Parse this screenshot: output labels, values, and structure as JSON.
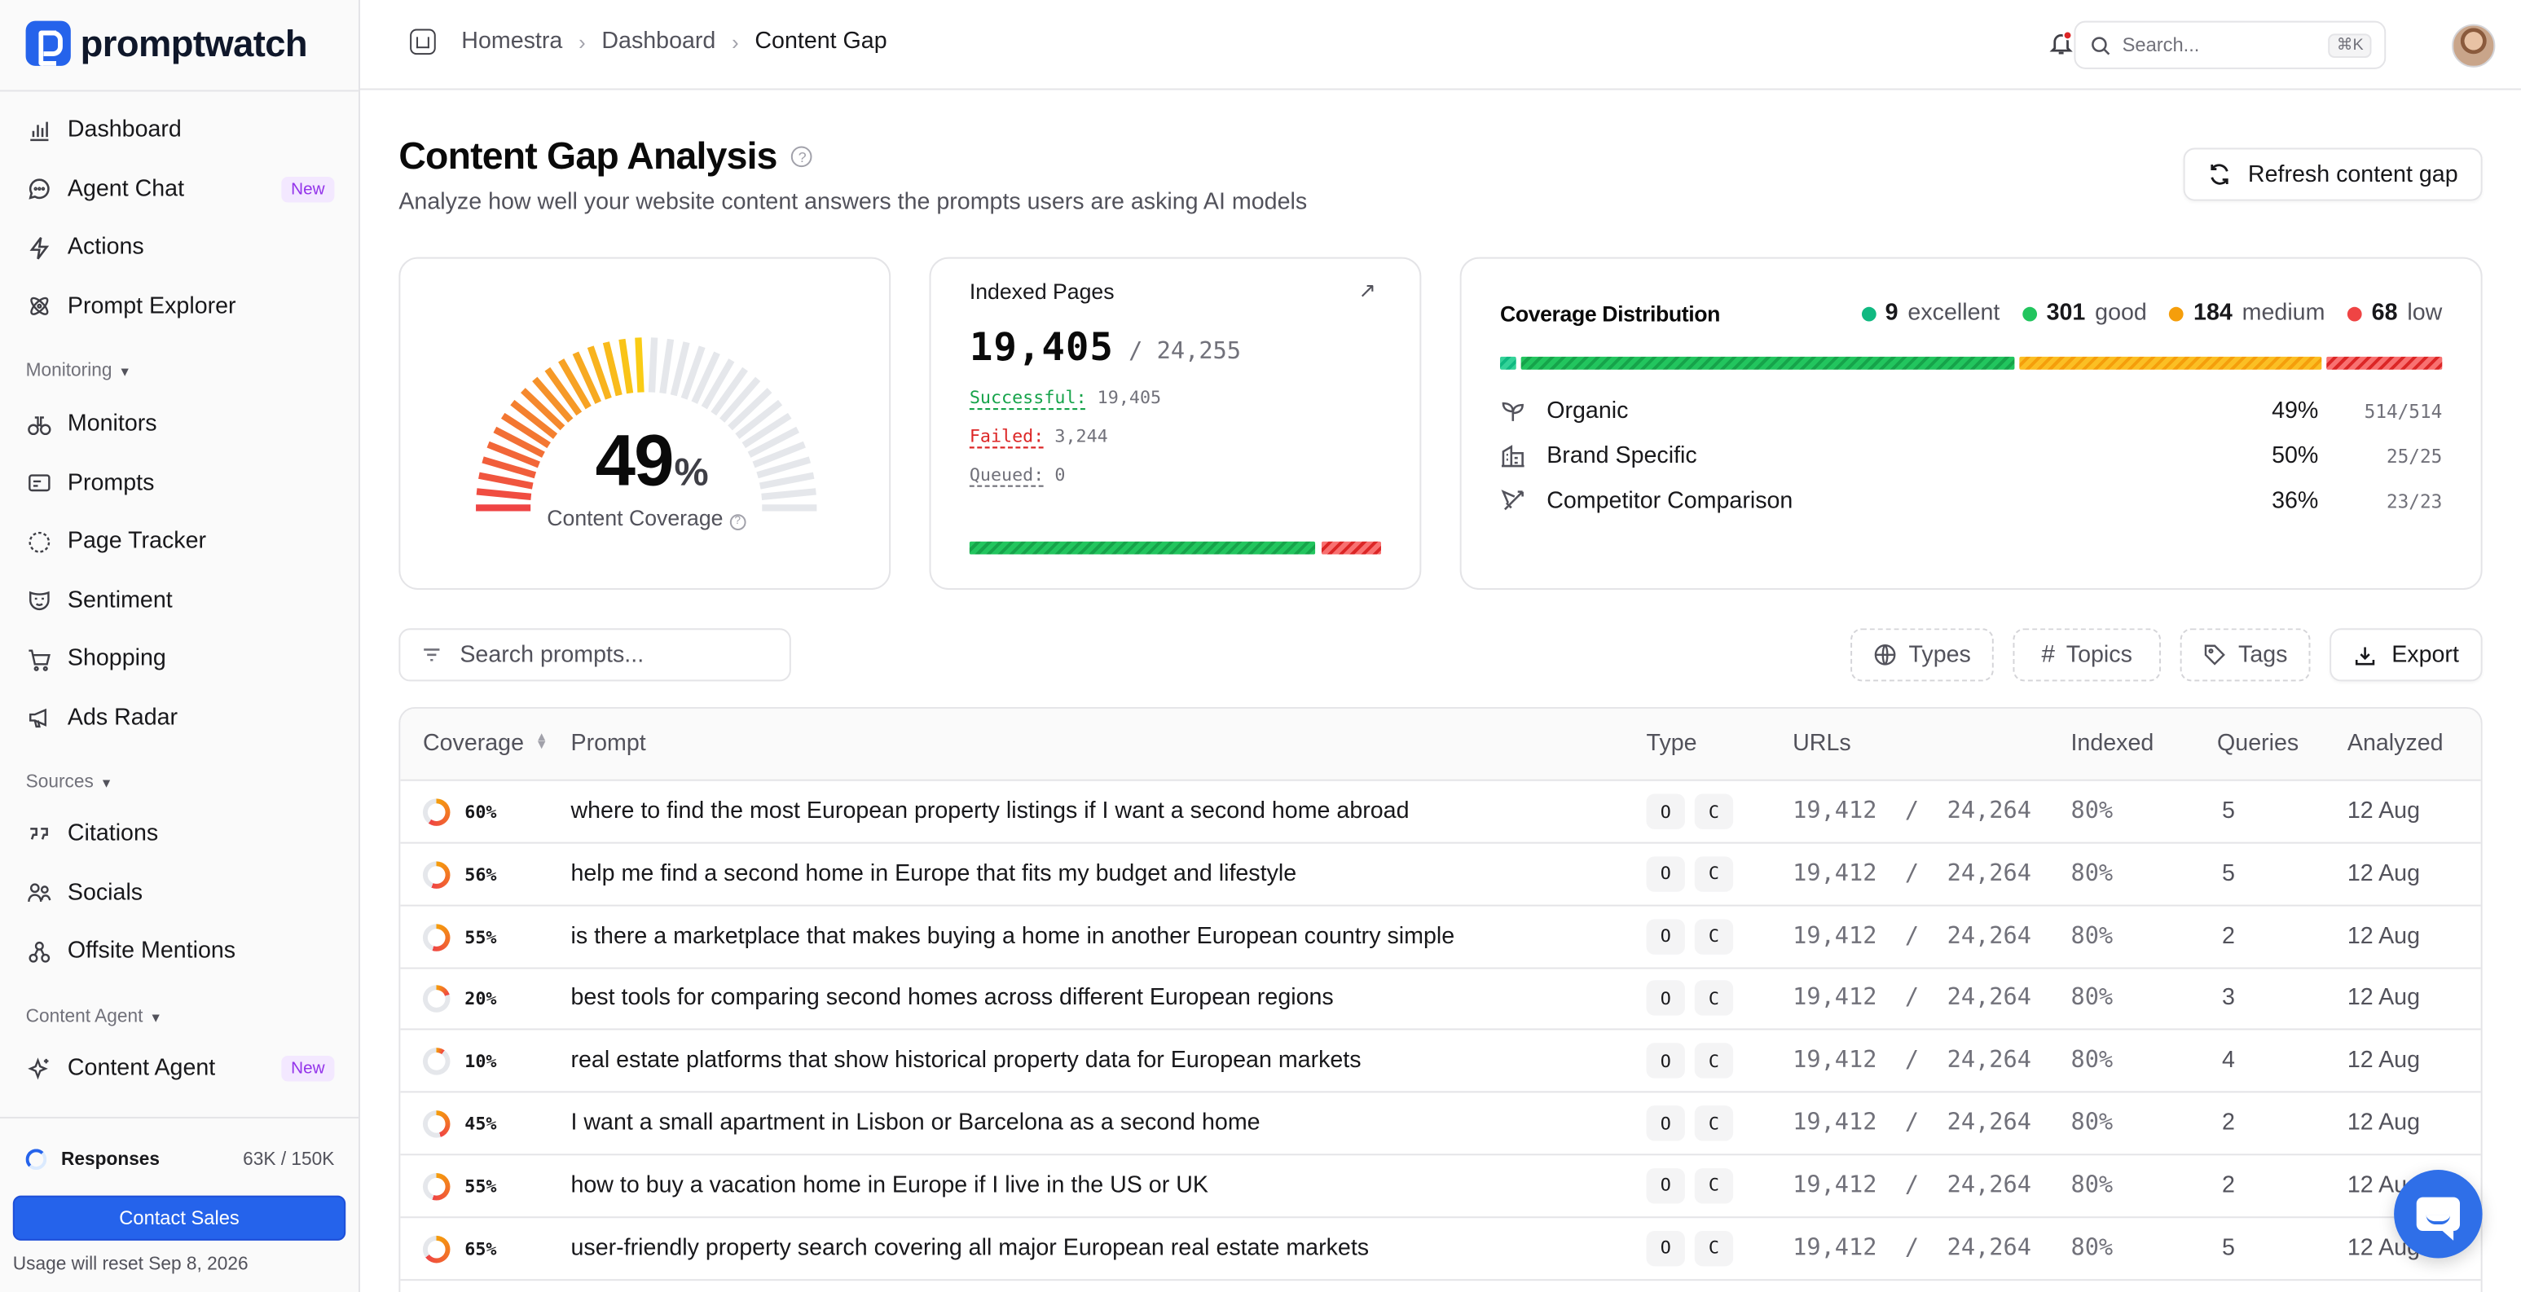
{
  "brand": {
    "name": "promptwatch"
  },
  "sidebar": {
    "items_top": [
      {
        "label": "Dashboard",
        "icon": "bar-chart-icon"
      },
      {
        "label": "Agent Chat",
        "icon": "chat-icon",
        "badge": "New"
      },
      {
        "label": "Actions",
        "icon": "bolt-icon"
      },
      {
        "label": "Prompt Explorer",
        "icon": "atom-icon"
      }
    ],
    "monitoring_label": "Monitoring",
    "monitoring_items": [
      {
        "label": "Monitors",
        "icon": "binoculars-icon"
      },
      {
        "label": "Prompts",
        "icon": "prompts-icon"
      },
      {
        "label": "Page Tracker",
        "icon": "page-tracker-icon"
      },
      {
        "label": "Sentiment",
        "icon": "mask-icon"
      },
      {
        "label": "Shopping",
        "icon": "cart-icon"
      },
      {
        "label": "Ads Radar",
        "icon": "megaphone-icon"
      }
    ],
    "sources_label": "Sources",
    "sources_items": [
      {
        "label": "Citations",
        "icon": "quote-icon"
      },
      {
        "label": "Socials",
        "icon": "users-icon"
      },
      {
        "label": "Offsite Mentions",
        "icon": "network-icon"
      }
    ],
    "content_agent_label": "Content Agent",
    "content_agent_items": [
      {
        "label": "Content Agent",
        "icon": "sparkle-icon",
        "badge": "New"
      }
    ],
    "responses_label": "Responses",
    "responses_value": "63K / 150K",
    "responses_progress": 0.42,
    "contact_label": "Contact Sales",
    "reset_note": "Usage will reset Sep 8, 2026"
  },
  "topbar": {
    "breadcrumb": [
      "Homestra",
      "Dashboard",
      "Content Gap"
    ],
    "search_placeholder": "Search...",
    "search_shortcut": "⌘K"
  },
  "page": {
    "title": "Content Gap Analysis",
    "subtitle": "Analyze how well your website content answers the prompts users are asking AI models",
    "refresh_label": "Refresh content gap"
  },
  "gauge": {
    "value": "49",
    "unit": "%",
    "label": "Content Coverage",
    "fraction": 0.49
  },
  "indexed": {
    "title": "Indexed Pages",
    "count": "19,405",
    "total": "/ 24,255",
    "successful_label": "Successful:",
    "successful_value": "19,405",
    "failed_label": "Failed:",
    "failed_value": "3,244",
    "queued_label": "Queued:",
    "queued_value": "0"
  },
  "distribution": {
    "title": "Coverage Distribution",
    "legend": [
      {
        "count": "9",
        "label": "excellent",
        "color": "#10b981"
      },
      {
        "count": "301",
        "label": "good",
        "color": "#22c55e"
      },
      {
        "count": "184",
        "label": "medium",
        "color": "#f59e0b"
      },
      {
        "count": "68",
        "label": "low",
        "color": "#ef4444"
      }
    ],
    "rows": [
      {
        "label": "Organic",
        "pct": "49%",
        "ratio": "514/514",
        "icon": "sprout-icon"
      },
      {
        "label": "Brand Specific",
        "pct": "50%",
        "ratio": "25/25",
        "icon": "building-icon"
      },
      {
        "label": "Competitor Comparison",
        "pct": "36%",
        "ratio": "23/23",
        "icon": "swords-icon"
      }
    ]
  },
  "filters": {
    "search_placeholder": "Search prompts...",
    "types": "Types",
    "topics": "Topics",
    "tags": "Tags",
    "export": "Export"
  },
  "table": {
    "headers": [
      "Coverage",
      "Prompt",
      "Type",
      "URLs",
      "Indexed",
      "Queries",
      "Analyzed"
    ],
    "rows": [
      {
        "coverage": "60%",
        "cov": 60,
        "prompt": "where to find the most European property listings if I want a second home abroad",
        "t1": "O",
        "t2": "C",
        "urls": "19,412  /  24,264",
        "indexed": "80%",
        "queries": "5",
        "analyzed": "12 Aug"
      },
      {
        "coverage": "56%",
        "cov": 56,
        "prompt": "help me find a second home in Europe that fits my budget and lifestyle",
        "t1": "O",
        "t2": "C",
        "urls": "19,412  /  24,264",
        "indexed": "80%",
        "queries": "5",
        "analyzed": "12 Aug"
      },
      {
        "coverage": "55%",
        "cov": 55,
        "prompt": "is there a marketplace that makes buying a home in another European country simple",
        "t1": "O",
        "t2": "C",
        "urls": "19,412  /  24,264",
        "indexed": "80%",
        "queries": "2",
        "analyzed": "12 Aug"
      },
      {
        "coverage": "20%",
        "cov": 20,
        "prompt": "best tools for comparing second homes across different European regions",
        "t1": "O",
        "t2": "C",
        "urls": "19,412  /  24,264",
        "indexed": "80%",
        "queries": "3",
        "analyzed": "12 Aug"
      },
      {
        "coverage": "10%",
        "cov": 10,
        "prompt": "real estate platforms that show historical property data for European markets",
        "t1": "O",
        "t2": "C",
        "urls": "19,412  /  24,264",
        "indexed": "80%",
        "queries": "4",
        "analyzed": "12 Aug"
      },
      {
        "coverage": "45%",
        "cov": 45,
        "prompt": "I want a small apartment in Lisbon or Barcelona as a second home",
        "t1": "O",
        "t2": "C",
        "urls": "19,412  /  24,264",
        "indexed": "80%",
        "queries": "2",
        "analyzed": "12 Aug"
      },
      {
        "coverage": "55%",
        "cov": 55,
        "prompt": "how to buy a vacation home in Europe if I live in the US or UK",
        "t1": "O",
        "t2": "C",
        "urls": "19,412  /  24,264",
        "indexed": "80%",
        "queries": "2",
        "analyzed": "12 Aug"
      },
      {
        "coverage": "65%",
        "cov": 65,
        "prompt": "user-friendly property search covering all major European real estate markets",
        "t1": "O",
        "t2": "C",
        "urls": "19,412  /  24,264",
        "indexed": "80%",
        "queries": "5",
        "analyzed": "12 Aug"
      }
    ]
  }
}
